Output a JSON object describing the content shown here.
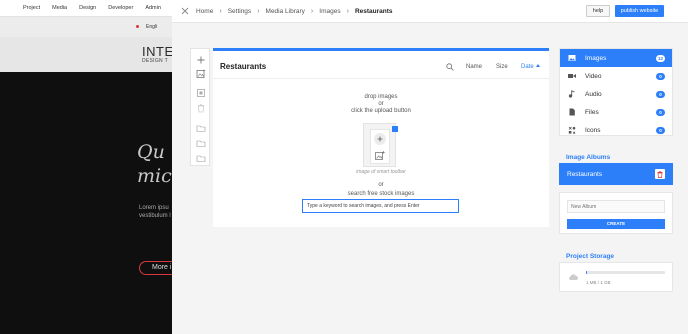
{
  "background": {
    "menu": [
      "Project",
      "Media",
      "Design",
      "Developer",
      "Admin"
    ],
    "language": "Engli",
    "header_title": "INTE",
    "header_subtitle": "DESIGN T",
    "hero_lines": [
      "Qu",
      "mic"
    ],
    "para_lines": [
      "Lorem ipsu",
      "vestibulum l"
    ],
    "more_button": "More i"
  },
  "header": {
    "breadcrumbs": [
      "Home",
      "Settings",
      "Media Library",
      "Images",
      "Restaurants"
    ],
    "separator": "›",
    "help_label": "help",
    "publish_label": "publish website"
  },
  "main": {
    "title": "Restaurants",
    "sort_name": "Name",
    "sort_size": "Size",
    "sort_date": "Date",
    "drop_line1": "drop images",
    "drop_line2": "or",
    "drop_line3": "click the upload button",
    "caption": "image of smart toolbar",
    "or_text": "or",
    "search_label": "search free stock images",
    "stock_value": "Type a keyword to search images, and press Enter"
  },
  "media_types": [
    {
      "label": "Images",
      "count": "12",
      "icon": "image-icon",
      "active": true
    },
    {
      "label": "Video",
      "count": "0",
      "icon": "video-icon",
      "active": false
    },
    {
      "label": "Audio",
      "count": "0",
      "icon": "audio-icon",
      "active": false
    },
    {
      "label": "Files",
      "count": "0",
      "icon": "file-icon",
      "active": false
    },
    {
      "label": "Icons",
      "count": "0",
      "icon": "icons-icon",
      "active": false
    }
  ],
  "albums": {
    "title": "Image Albums",
    "items": [
      "Restaurants"
    ],
    "new_placeholder": "New Album",
    "create_label": "CREATE"
  },
  "storage": {
    "title": "Project Storage",
    "used_text": "1 MB / 1 GB",
    "fraction_used": 0.01
  },
  "colors": {
    "accent": "#2d7ff9",
    "danger": "#d9393e"
  }
}
